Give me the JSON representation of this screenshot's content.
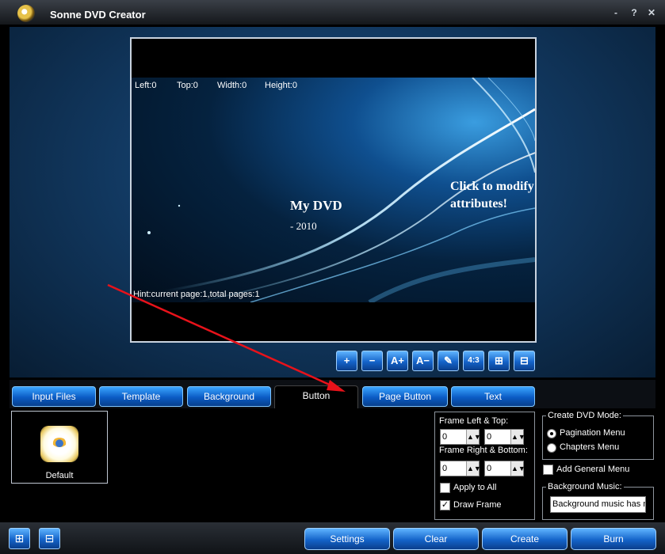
{
  "window": {
    "title": "Sonne DVD Creator",
    "help_glyph": "?",
    "minimize_glyph": "-",
    "close_glyph": "✕"
  },
  "preview": {
    "info": {
      "left": "Left:0",
      "top": "Top:0",
      "width": "Width:0",
      "height": "Height:0"
    },
    "menu_title": "My DVD",
    "menu_subtitle": "- 2010",
    "click_hint": "Click to modify attributes!",
    "hint": "Hint:current page:1,total pages:1"
  },
  "toolbar": [
    {
      "name": "zoom-in-button",
      "glyph": "+"
    },
    {
      "name": "zoom-out-button",
      "glyph": "−"
    },
    {
      "name": "font-larger-button",
      "glyph": "A+"
    },
    {
      "name": "font-smaller-button",
      "glyph": "A−"
    },
    {
      "name": "draw-tool-button",
      "glyph": "✎"
    },
    {
      "name": "aspect-ratio-button",
      "glyph": "4:3"
    },
    {
      "name": "add-item-button",
      "glyph": "⊞"
    },
    {
      "name": "remove-item-button",
      "glyph": "⊟"
    }
  ],
  "tabs": [
    "Input Files",
    "Template",
    "Background",
    "Button",
    "Page Button",
    "Text"
  ],
  "active_tab": "Button",
  "thumbnail": {
    "label": "Default"
  },
  "frame_panel": {
    "left_top_label": "Frame Left & Top:",
    "right_bottom_label": "Frame Right & Bottom:",
    "left": "0",
    "top": "0",
    "right": "0",
    "bottom": "0",
    "apply_to_all": "Apply to All",
    "draw_frame": "Draw Frame"
  },
  "dvd_mode": {
    "title": "Create DVD Mode:",
    "pagination": "Pagination Menu",
    "chapters": "Chapters Menu",
    "add_general": "Add General Menu"
  },
  "music": {
    "title": "Background Music:",
    "value": "Background music has no"
  },
  "buttons": {
    "settings": "Settings",
    "clear": "Clear",
    "create": "Create",
    "burn": "Burn"
  }
}
